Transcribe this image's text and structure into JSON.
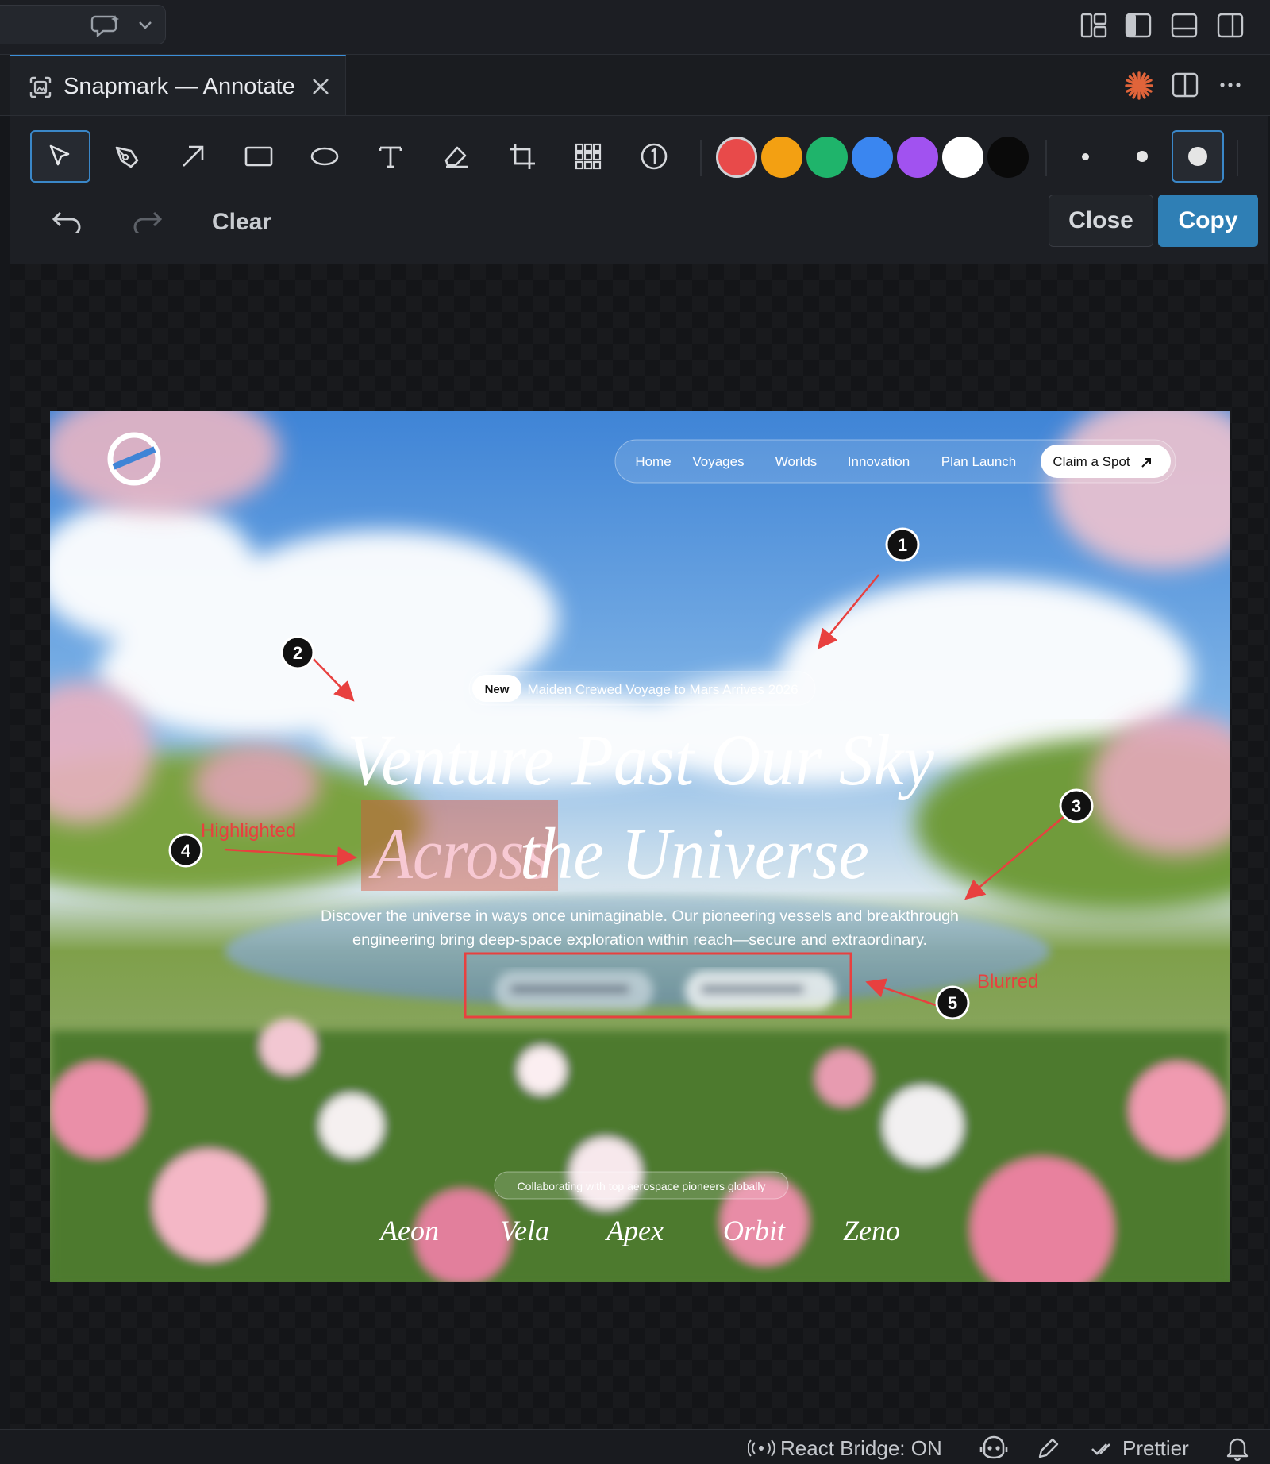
{
  "tab": {
    "title": "Snapmark — Annotate"
  },
  "toolbar": {
    "tools": [
      "select-tool",
      "pen-tool",
      "arrow-tool",
      "rectangle-tool",
      "ellipse-tool",
      "text-tool",
      "highlighter-tool",
      "crop-tool",
      "blur-tool",
      "step-counter-tool"
    ],
    "colors": [
      "#e84a4a",
      "#f3a012",
      "#1fb46b",
      "#3a86f0",
      "#a152f0",
      "#ffffff",
      "#0a0a0a"
    ],
    "selected_color": "#ffffff",
    "stroke_sizes": [
      "small",
      "medium",
      "large"
    ],
    "selected_size": "large",
    "undo_icon": "undo-icon",
    "redo_icon": "redo-icon",
    "clear_label": "Clear",
    "close_label": "Close",
    "copy_label": "Copy"
  },
  "image": {
    "nav": [
      "Home",
      "Voyages",
      "Worlds",
      "Innovation",
      "Plan Launch"
    ],
    "cta": "Claim a Spot",
    "badge_new": "New",
    "badge_text": "Maiden Crewed Voyage to Mars Arrives 2026",
    "headline_line1": "Venture Past Our Sky",
    "headline_highlight": "Across",
    "headline_line2_rest": "the Universe",
    "subtitle_line1": "Discover the universe in ways once unimaginable. Our pioneering vessels and breakthrough",
    "subtitle_line2": "engineering bring deep-space exploration within reach—secure and extraordinary.",
    "partners_caption": "Collaborating with top aerospace pioneers globally",
    "partners": [
      "Aeon",
      "Vela",
      "Apex",
      "Orbit",
      "Zeno"
    ]
  },
  "annotations": {
    "steps": [
      "1",
      "2",
      "3",
      "4",
      "5"
    ],
    "highlight_label": "Highlighted",
    "blur_label": "Blurred",
    "accent_color": "#e8403f"
  },
  "status": {
    "react_bridge": "React Bridge: ON",
    "prettier": "Prettier"
  }
}
